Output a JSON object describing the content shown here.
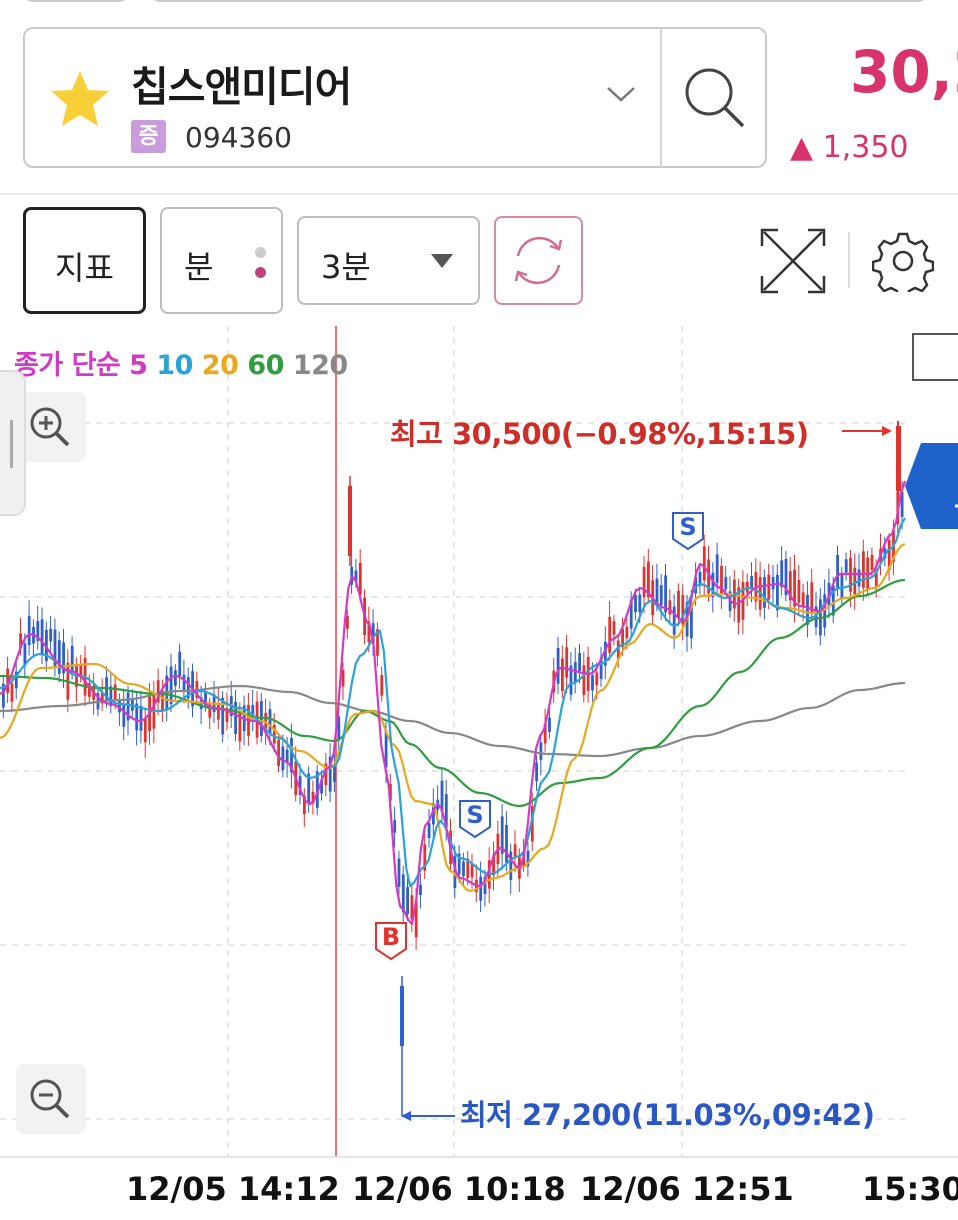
{
  "stock": {
    "name": "칩스앤미디어",
    "market_badge": "증",
    "code": "094360",
    "price": "30,2",
    "change": "▲ 1,350"
  },
  "toolbar": {
    "indicator_label": "지표",
    "minute_label": "분",
    "interval_label": "3분"
  },
  "legend": {
    "title": "종가 단순",
    "ma5": "5",
    "ma10": "10",
    "ma20": "20",
    "ma60": "60",
    "ma120": "120"
  },
  "colors": {
    "up": "#e0332f",
    "down": "#2f5fcf",
    "ma5": "#d23ac4",
    "ma10": "#2aa3d6",
    "ma20": "#e6a91f",
    "ma60": "#2e9e3e",
    "ma120": "#888888",
    "accent": "#d9336b"
  },
  "annotations": {
    "high": "최고 30,500(−0.98%,15:15)",
    "low": "최저 27,200(11.03%,09:42)",
    "buy_marker": "B",
    "sell_marker": "S"
  },
  "time_axis": {
    "t1": "12/05 14:12",
    "t2": "12/06 10:18",
    "t3": "12/06 12:51",
    "t4": "15:30"
  },
  "chart_data": {
    "type": "line",
    "interval": "3분",
    "series": [
      {
        "name": "5",
        "values": [
          28810,
          28760,
          28740,
          28700,
          28720,
          28600,
          28450,
          28550,
          28700,
          28300,
          27900,
          28100,
          28300,
          28600,
          28700,
          28750,
          28650,
          28700,
          29000,
          29250,
          29150,
          29300,
          29200,
          29350,
          29500,
          29650,
          30050
        ]
      },
      {
        "name": "10",
        "values": [
          28800,
          28770,
          28750,
          28720,
          28700,
          28640,
          28540,
          28540,
          28600,
          28420,
          28100,
          28050,
          28200,
          28450,
          28620,
          28720,
          28700,
          28690,
          28880,
          29100,
          29150,
          29230,
          29250,
          29300,
          29420,
          29550,
          29850
        ]
      }
    ],
    "high": "30,500",
    "low": "27,200",
    "ylim": [
      27100,
      30600
    ]
  }
}
